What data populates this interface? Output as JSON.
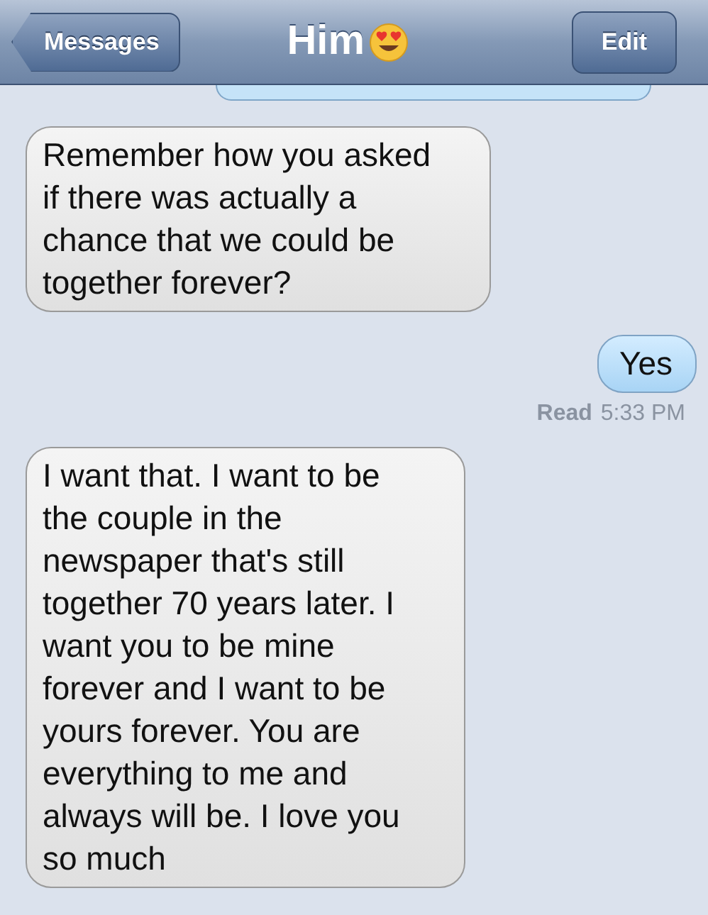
{
  "nav_bar": {
    "back_button": "Messages",
    "title": "Him",
    "edit_button": "Edit"
  },
  "messages": [
    {
      "outgoing": true,
      "kind": "clipped"
    },
    {
      "outgoing": false,
      "kind": "text",
      "text": "Remember how you asked if there was actually a chance that we could be together forever?"
    },
    {
      "outgoing": true,
      "kind": "text",
      "text": "Yes"
    },
    {
      "outgoing": true,
      "kind": "receipt",
      "label": "Read",
      "time": "5:33 PM"
    },
    {
      "outgoing": false,
      "kind": "text",
      "text": "I want that. I want to be the couple in the newspaper that's still together 70 years later. I want you to be mine forever and I want to be yours forever. You are everything to me and always will be. I love you so much"
    }
  ]
}
